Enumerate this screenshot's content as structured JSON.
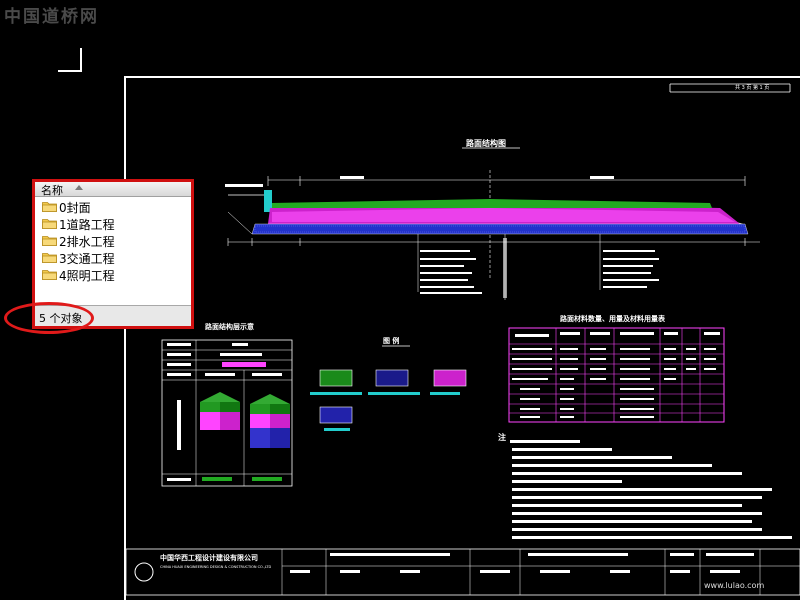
{
  "watermark": "中国道桥网",
  "explorer": {
    "column_header": "名称",
    "items": [
      {
        "label": "0封面",
        "icon": "folder-icon"
      },
      {
        "label": "1道路工程",
        "icon": "folder-icon"
      },
      {
        "label": "2排水工程",
        "icon": "folder-icon"
      },
      {
        "label": "3交通工程",
        "icon": "folder-icon"
      },
      {
        "label": "4照明工程",
        "icon": "folder-icon"
      }
    ],
    "status_text": "5 个对象"
  },
  "drawing": {
    "page_marker": "共 3 页   第 1 页",
    "section_title": "路面结构图",
    "materials_title": "路面材料数量、用量及材料用量表",
    "structure_table_title": "路面结构层示意",
    "legend_title": "图  例",
    "notes_marker": "注",
    "company_name": "中国华西工程设计建设有限公司",
    "company_name_en": "CHINA HUAXI ENGINEERING DESIGN & CONSTRUCTION CO.,LTD",
    "watermark_br": "www.lulao.com"
  },
  "colors": {
    "background": "#000000",
    "explorer_border": "#d01010",
    "highlight_circle": "#e01a1a",
    "cad_magenta": "#ff44ff",
    "cad_green": "#33cc33",
    "cad_blue": "#3333ff",
    "cad_yellow": "#ffff66"
  }
}
